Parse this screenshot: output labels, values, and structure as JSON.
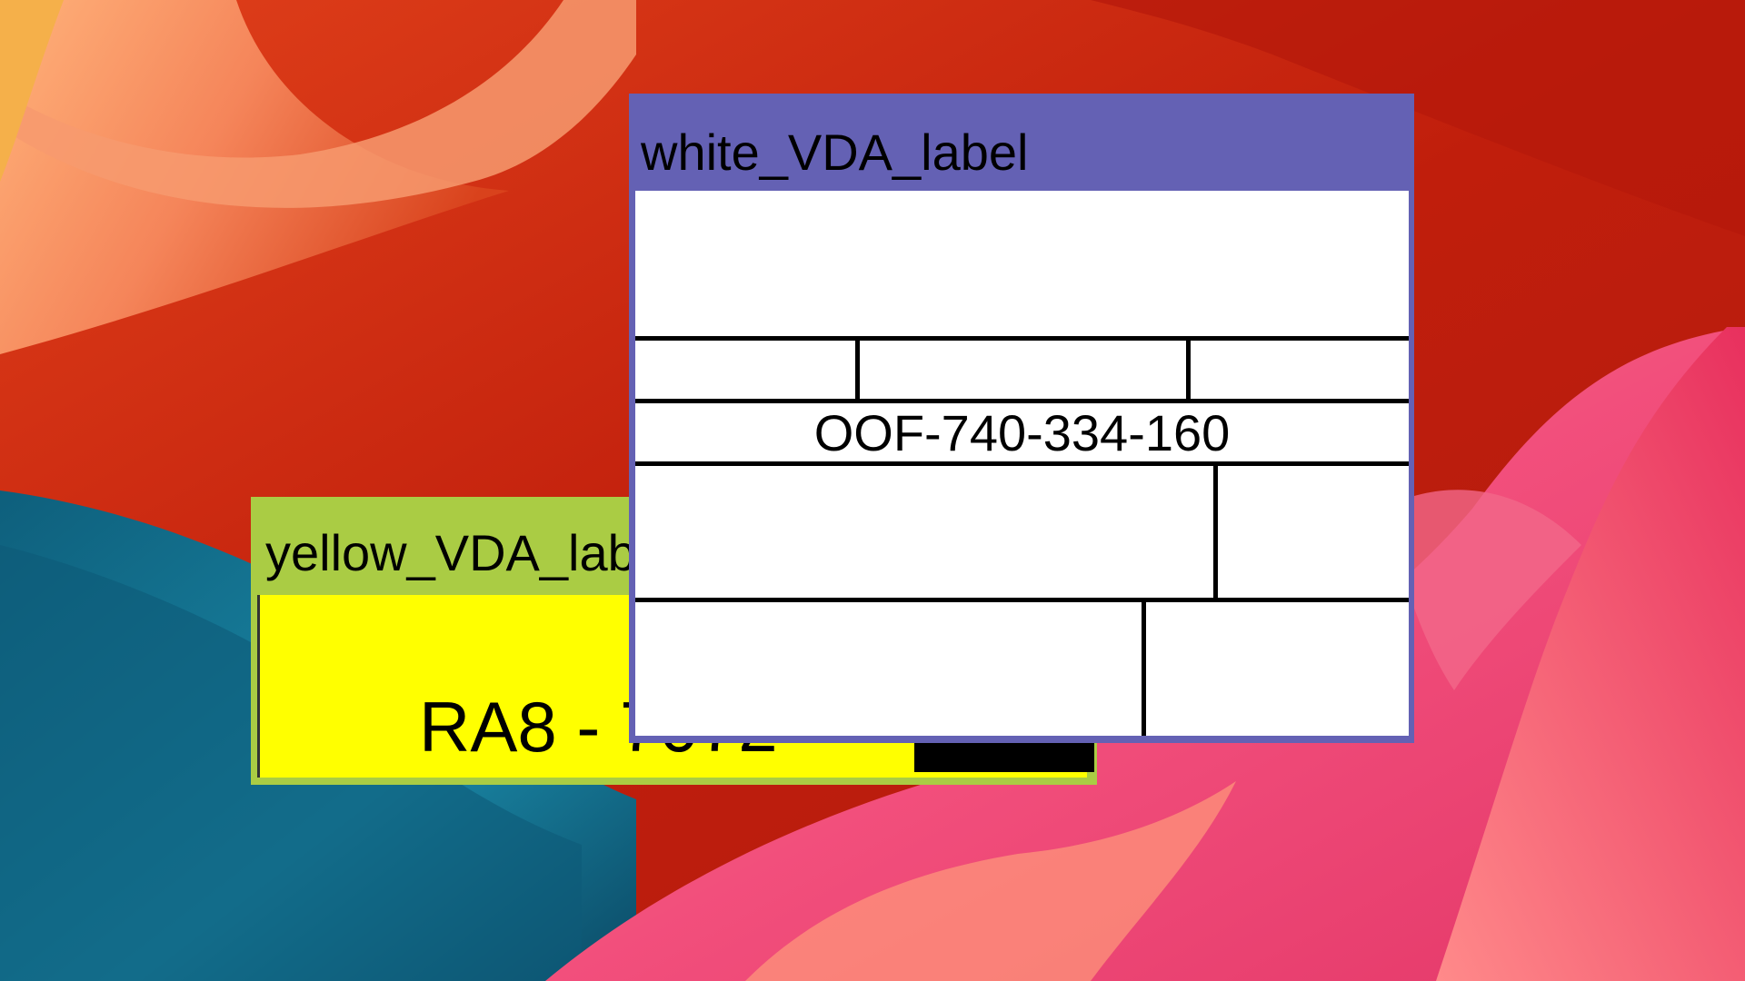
{
  "desktop": {
    "wallpaper": "abstract-silk-waves",
    "colors": {
      "red": "#c8260f",
      "orange": "#f08a5d",
      "teal": "#1f7a93",
      "pink": "#f04a7a"
    }
  },
  "windows": [
    {
      "id": "white",
      "title": "white_VDA_label",
      "frame_color": "#6461b4",
      "content_color": "#ffffff",
      "code": "OOF-740-334-160"
    },
    {
      "id": "yellow",
      "title": "yellow_VDA_label",
      "frame_color": "#aacc44",
      "content_color": "#ffff00",
      "code": "RA8 - 7072"
    }
  ]
}
